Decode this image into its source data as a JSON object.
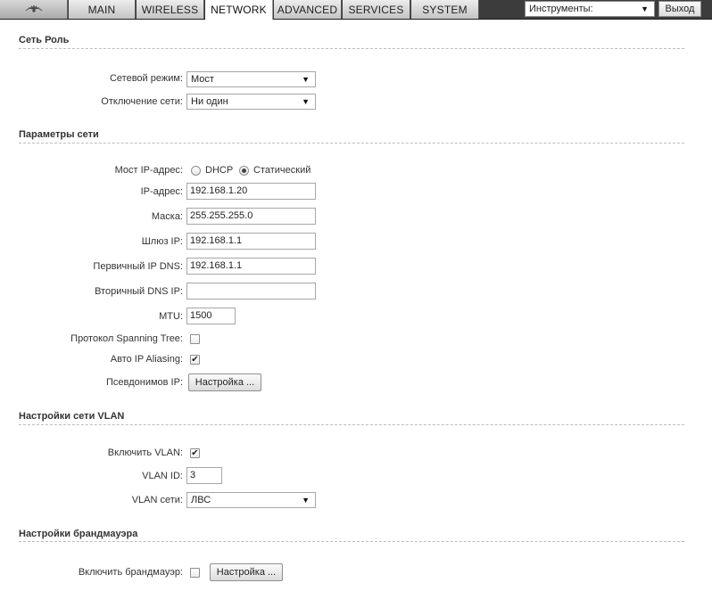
{
  "nav": {
    "tabs": [
      {
        "label": "MAIN",
        "active": false
      },
      {
        "label": "WIRELESS",
        "active": false
      },
      {
        "label": "NETWORK",
        "active": true
      },
      {
        "label": "ADVANCED",
        "active": false
      },
      {
        "label": "SERVICES",
        "active": false
      },
      {
        "label": "SYSTEM",
        "active": false
      }
    ],
    "tools_value": "Инструменты:",
    "logout_label": "Выход"
  },
  "network_role": {
    "title": "Сеть Роль",
    "network_mode_label": "Сетевой режим:",
    "network_mode_value": "Мост",
    "disable_network_label": "Отключение сети:",
    "disable_network_value": "Ни один"
  },
  "network_settings": {
    "title": "Параметры сети",
    "bridge_ip_label": "Мост IP-адрес:",
    "dhcp_label": "DHCP",
    "static_label": "Статический",
    "selected_mode": "static",
    "ip_label": "IP-адрес:",
    "ip_value": "192.168.1.20",
    "mask_label": "Маска:",
    "mask_value": "255.255.255.0",
    "gateway_label": "Шлюз IP:",
    "gateway_value": "192.168.1.1",
    "dns1_label": "Первичный IP DNS:",
    "dns1_value": "192.168.1.1",
    "dns2_label": "Вторичный DNS IP:",
    "dns2_value": "",
    "mtu_label": "MTU:",
    "mtu_value": "1500",
    "stp_label": "Протокол Spanning Tree:",
    "stp_checked": false,
    "auto_alias_label": "Авто IP Aliasing:",
    "auto_alias_checked": true,
    "aliases_label": "Псевдонимов IP:",
    "aliases_button": "Настройка ..."
  },
  "vlan": {
    "title": "Настройки сети VLAN",
    "enable_label": "Включить VLAN:",
    "enable_checked": true,
    "id_label": "VLAN ID:",
    "id_value": "3",
    "network_label": "VLAN сети:",
    "network_value": "ЛВС"
  },
  "firewall": {
    "title": "Настройки брандмауэра",
    "enable_label": "Включить брандмауэр:",
    "enable_checked": false,
    "settings_button": "Настройка ..."
  },
  "colors": {
    "topbar": "#3c3c3c",
    "tab_bg": "#d0d0d0",
    "active_tab_bg": "#ffffff",
    "rule": "#bdbdbd"
  },
  "icons": {
    "logo": "ubiquiti-logo-icon",
    "dropdown": "triangle-down-icon",
    "check": "checkmark-icon"
  }
}
